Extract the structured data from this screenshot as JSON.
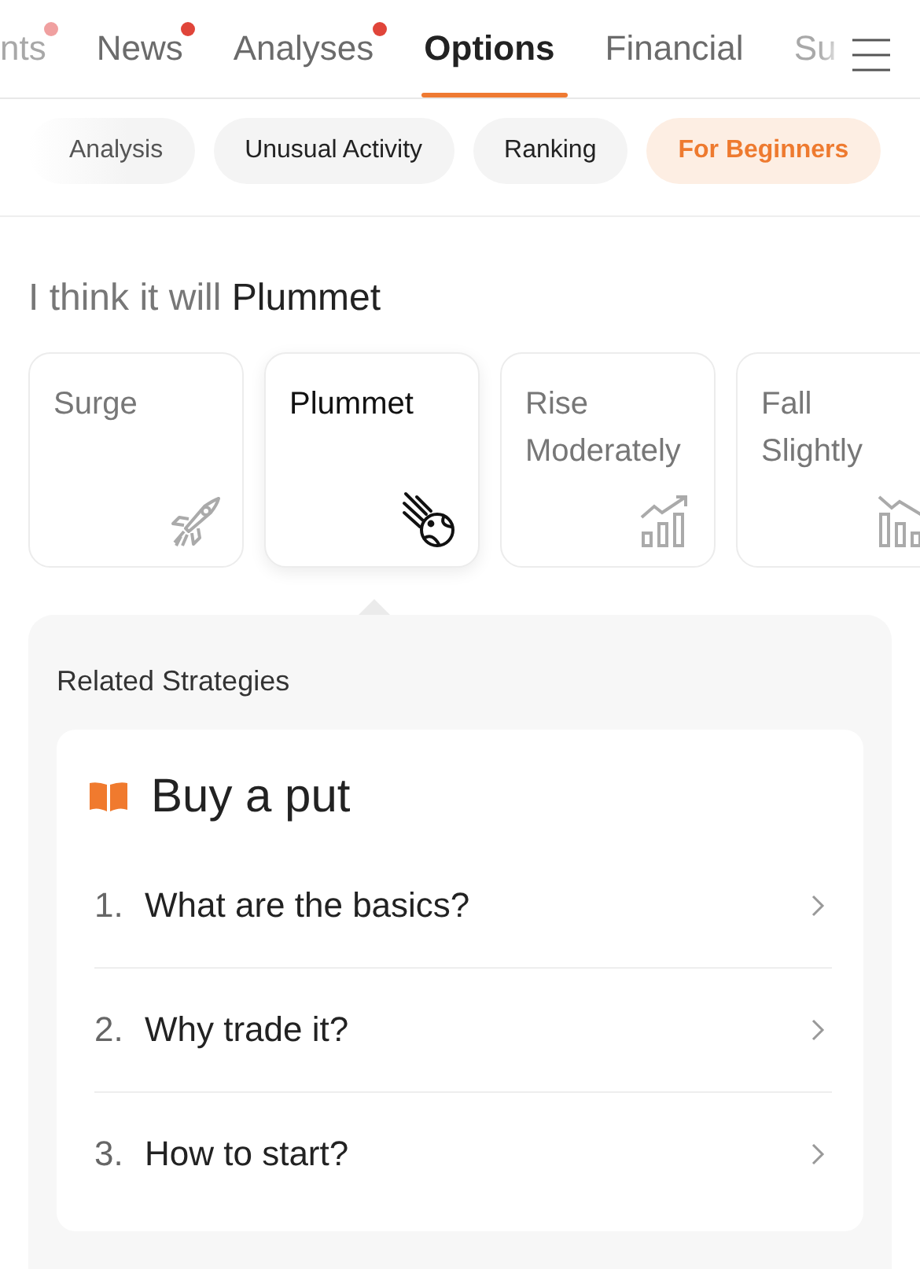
{
  "tabs": [
    {
      "label": "nts",
      "dot": true,
      "selected": false
    },
    {
      "label": "News",
      "dot": true,
      "selected": false
    },
    {
      "label": "Analyses",
      "dot": true,
      "selected": false
    },
    {
      "label": "Options",
      "dot": false,
      "selected": true
    },
    {
      "label": "Financial",
      "dot": false,
      "selected": false
    },
    {
      "label": "Su",
      "dot": false,
      "selected": false
    }
  ],
  "chips": [
    {
      "label": "Analysis",
      "selected": false
    },
    {
      "label": "Unusual Activity",
      "selected": false
    },
    {
      "label": "Ranking",
      "selected": false
    },
    {
      "label": "For Beginners",
      "selected": true
    }
  ],
  "headline": {
    "prefix": "I think it will",
    "choice": "Plummet"
  },
  "outlooks": [
    {
      "label": "Surge",
      "kind": "rocket",
      "selected": false
    },
    {
      "label": "Plummet",
      "kind": "meteor",
      "selected": true
    },
    {
      "label": "Rise Moderately",
      "kind": "rise",
      "selected": false
    },
    {
      "label": "Fall Slightly",
      "kind": "fall",
      "selected": false
    }
  ],
  "related": {
    "title": "Related Strategies",
    "strategy": "Buy a put",
    "items": [
      {
        "number": "1.",
        "text": "What are the basics?"
      },
      {
        "number": "2.",
        "text": "Why trade it?"
      },
      {
        "number": "3.",
        "text": "How to start?"
      }
    ]
  }
}
